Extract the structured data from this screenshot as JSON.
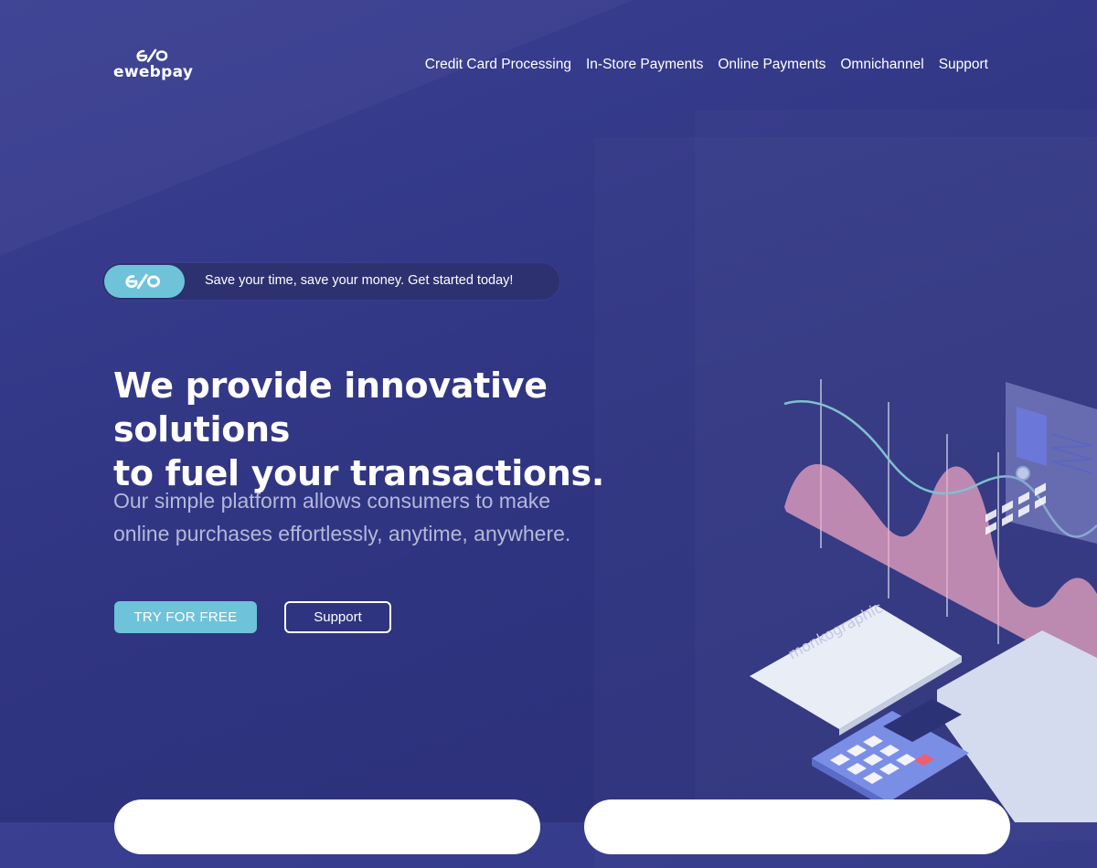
{
  "brand": {
    "name": "ewebpay",
    "accent_color": "#6ec3d9",
    "background_color": "#333887"
  },
  "nav": {
    "items": [
      {
        "label": "Credit Card Processing"
      },
      {
        "label": "In-Store Payments"
      },
      {
        "label": "Online Payments"
      },
      {
        "label": "Omnichannel"
      },
      {
        "label": "Support"
      }
    ]
  },
  "banner": {
    "icon": "ewebpay-logo-icon",
    "text": "Save your time, save your money. Get started today!"
  },
  "hero": {
    "headline_line1": "We provide innovative solutions",
    "headline_line2": "to fuel your transactions.",
    "subline_line1": "Our simple platform allows consumers to make",
    "subline_line2": "online purchases effortlessly, anytime, anywhere.",
    "cta_primary": "TRY FOR FREE",
    "cta_secondary": "Support"
  },
  "illustration": {
    "watermark": "monkographic"
  }
}
